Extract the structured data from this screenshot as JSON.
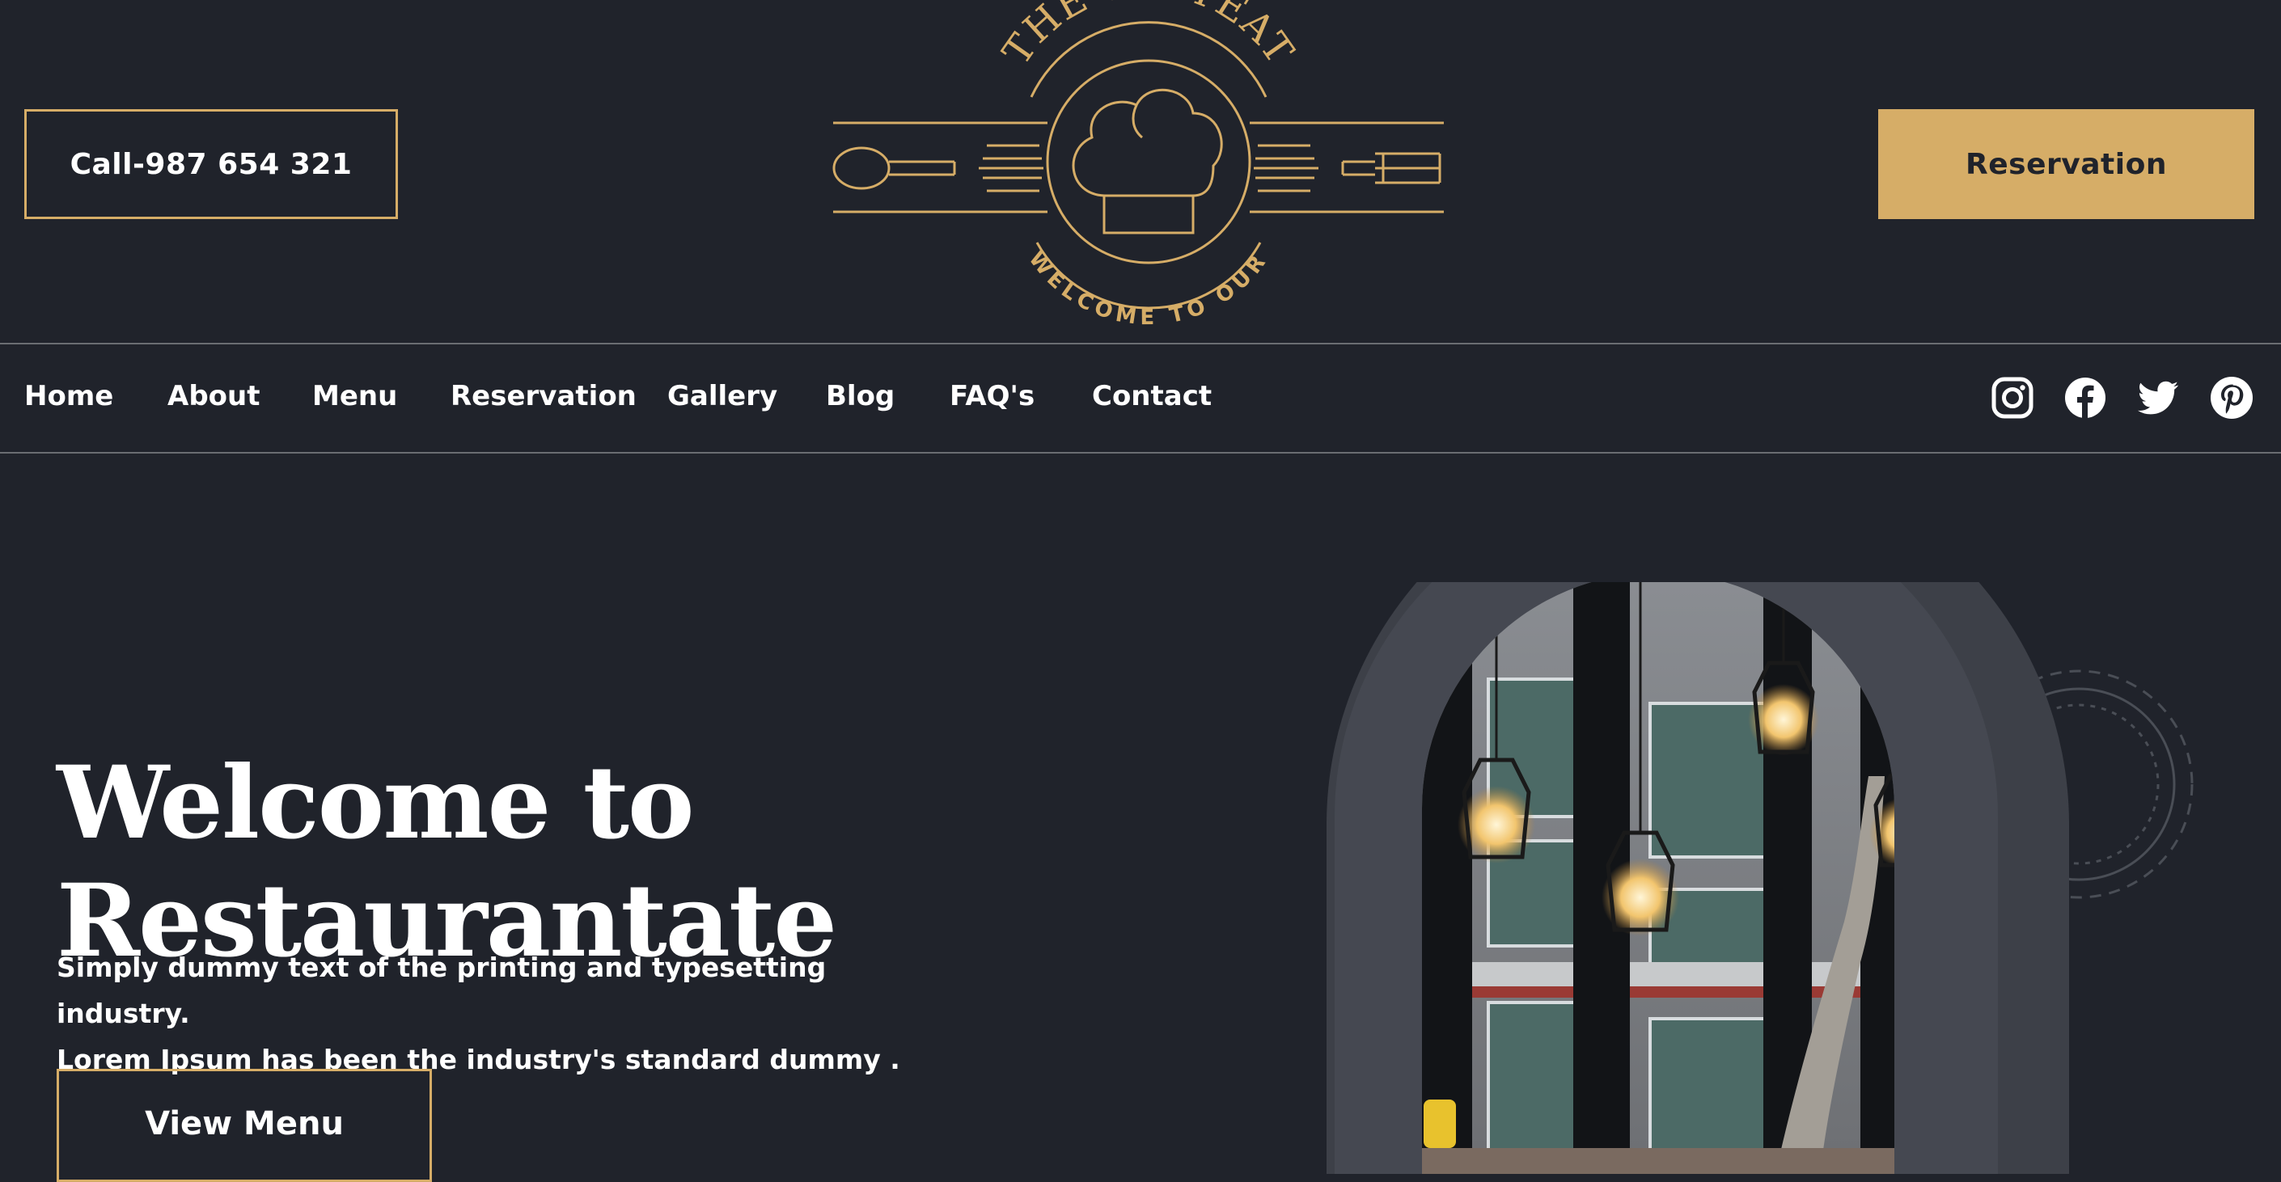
{
  "header": {
    "call_label": "Call-987 654 321",
    "reservation_label": "Reservation",
    "logo": {
      "top_text": "THE TASTEAT",
      "bottom_text": "WELCOME TO OUR",
      "color": "#d6ad67"
    }
  },
  "nav": {
    "items": [
      {
        "label": "Home"
      },
      {
        "label": "About"
      },
      {
        "label": "Menu"
      },
      {
        "label": "Reservation"
      },
      {
        "label": "Gallery"
      },
      {
        "label": "Blog"
      },
      {
        "label": "FAQ's"
      },
      {
        "label": "Contact"
      }
    ],
    "social": [
      "instagram-icon",
      "facebook-icon",
      "twitter-icon",
      "pinterest-icon"
    ]
  },
  "hero": {
    "title_line1": "Welcome to",
    "title_line2": "Restaurantate",
    "text_line1": "Simply dummy text of the printing and typesetting industry.",
    "text_line2": "Lorem Ipsum has been the industry's standard dummy .",
    "view_menu_label": "View Menu"
  },
  "colors": {
    "background": "#20232b",
    "accent": "#d6ad67",
    "text": "#ffffff"
  }
}
